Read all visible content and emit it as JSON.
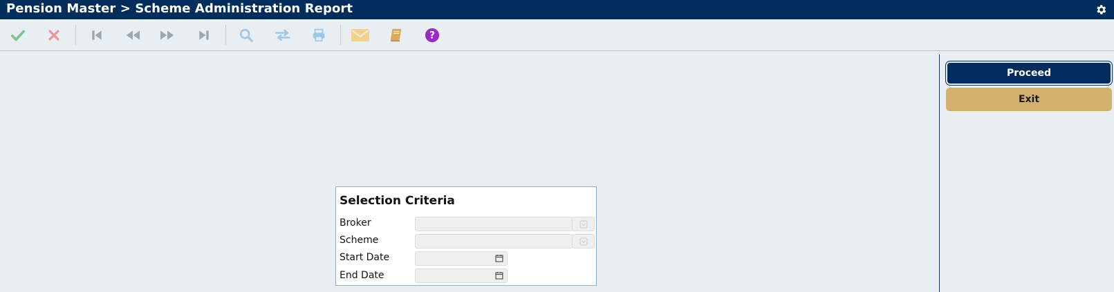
{
  "window": {
    "title": "Pension Master > Scheme Administration Report"
  },
  "toolbar": {
    "icons": [
      "check-icon",
      "close-icon",
      "first-icon",
      "rewind-icon",
      "forward-icon",
      "last-icon",
      "search-icon",
      "swap-icon",
      "print-icon",
      "mail-icon",
      "book-icon",
      "help-icon"
    ],
    "colors": {
      "check": "#7cc58f",
      "close": "#e8999a",
      "nav": "#9aa6b2",
      "search": "#9fc7e8",
      "mail": "#f2d28a",
      "book": "#d9a95c",
      "help": "#9b2bc8"
    }
  },
  "actions": {
    "proceed_label": "Proceed",
    "exit_label": "Exit"
  },
  "selection": {
    "title": "Selection Criteria",
    "fields": [
      {
        "label": "Broker",
        "value": ""
      },
      {
        "label": "Scheme",
        "value": ""
      },
      {
        "label": "Start Date",
        "value": ""
      },
      {
        "label": "End Date",
        "value": ""
      }
    ]
  },
  "theme": {
    "header_bg": "#002d5c",
    "page_bg": "#e9eef2",
    "exit_bg": "#d4b06e"
  }
}
